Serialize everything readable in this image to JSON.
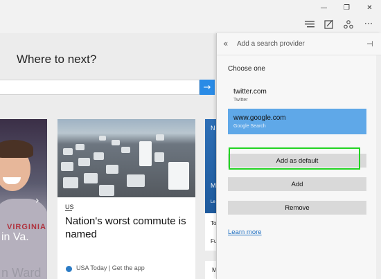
{
  "window": {
    "minimize_glyph": "—",
    "restore_glyph": "❐",
    "close_glyph": "✕"
  },
  "toolbar": {
    "icons": [
      "hub-icon",
      "web-note-icon",
      "share-icon",
      "more-icon"
    ],
    "more_glyph": "···"
  },
  "page": {
    "heading": "Where to next?",
    "search_go_glyph": "→",
    "left_card": {
      "caption": "in Va.",
      "caption2": "n Ward",
      "shirt_text": "VIRGINIA"
    },
    "mid_card": {
      "category": "US",
      "headline": "Nation's worst commute is named",
      "source": "USA Today | Get the app"
    },
    "right_card": {
      "letters": [
        "N",
        "M",
        "Le",
        "To",
        "Fu",
        "M"
      ]
    }
  },
  "panel": {
    "title": "Add a search provider",
    "choose_label": "Choose one",
    "providers": [
      {
        "name": "twitter.com",
        "sub": "Twitter",
        "selected": false
      },
      {
        "name": "www.google.com",
        "sub": "Google Search",
        "selected": true
      }
    ],
    "buttons": {
      "add_default": "Add as default",
      "add": "Add",
      "remove": "Remove"
    },
    "learn_more": "Learn more"
  },
  "colors": {
    "accent": "#2a8be6",
    "selected": "#5fa8e8",
    "highlight": "#22d322",
    "link": "#1e6fc2"
  }
}
